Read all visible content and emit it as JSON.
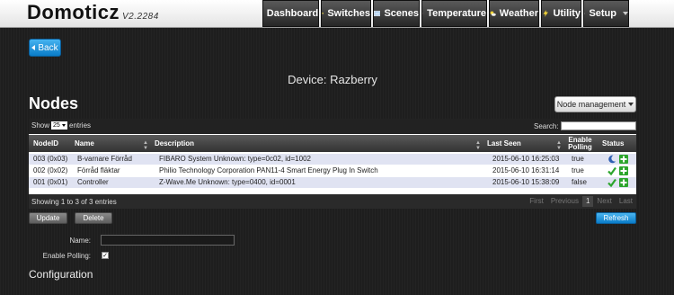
{
  "app": {
    "name": "Domoticz",
    "version": "V2.2284"
  },
  "nav": {
    "dashboard": "Dashboard",
    "switches": "Switches",
    "scenes": "Scenes",
    "temperature": "Temperature",
    "weather": "Weather",
    "utility": "Utility",
    "setup": "Setup"
  },
  "back_label": "Back",
  "device_title": "Device: Razberry",
  "nodes_heading": "Nodes",
  "node_management_label": "Node management",
  "table": {
    "show_prefix": "Show",
    "show_value": "25",
    "show_suffix": "entries",
    "search_label": "Search:",
    "headers": {
      "nodeid": "NodeID",
      "name": "Name",
      "description": "Description",
      "last_seen": "Last Seen",
      "enable_polling_1": "Enable",
      "enable_polling_2": "Polling",
      "status": "Status"
    },
    "rows": [
      {
        "nodeid": "003 (0x03)",
        "name": "B-varnare Förråd",
        "description": "FIBARO System Unknown: type=0c02, id=1002",
        "last_seen": "2015-06-10 16:25:03",
        "polling": "true",
        "status_icon": "moon-icon"
      },
      {
        "nodeid": "002 (0x02)",
        "name": "Förråd fläktar",
        "description": "Philio Technology Corporation PAN11-4 Smart Energy Plug In Switch",
        "last_seen": "2015-06-10 16:31:14",
        "polling": "true",
        "status_icon": "checkmark-icon"
      },
      {
        "nodeid": "001 (0x01)",
        "name": "Controller",
        "description": "Z-Wave.Me Unknown: type=0400, id=0001",
        "last_seen": "2015-06-10 15:38:09",
        "polling": "false",
        "status_icon": "checkmark-icon"
      }
    ],
    "showing": "Showing 1 to 3 of 3 entries",
    "pager": {
      "first": "First",
      "previous": "Previous",
      "page": "1",
      "next": "Next",
      "last": "Last"
    }
  },
  "buttons": {
    "update": "Update",
    "delete": "Delete",
    "refresh": "Refresh"
  },
  "form": {
    "name_label": "Name:",
    "name_value": "",
    "polling_label": "Enable Polling:",
    "polling_checked": true
  },
  "config_heading": "Configuration",
  "colors": {
    "accent_blue": "#0a7cc8",
    "row_stripe": "#e0e3f2",
    "check_green": "#2ca52c",
    "nav_dark": "#333333"
  }
}
